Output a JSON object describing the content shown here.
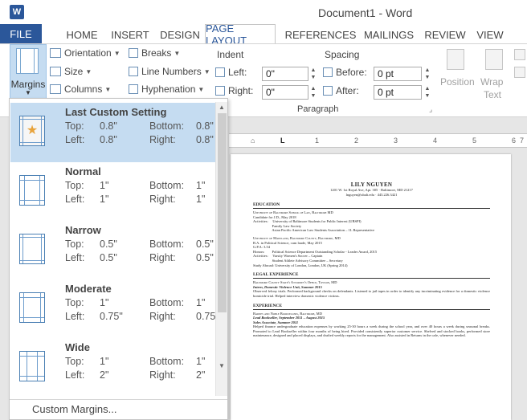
{
  "titlebar": {
    "app_icon": "W",
    "title": "Document1 - Word"
  },
  "tabs": [
    "FILE",
    "HOME",
    "INSERT",
    "DESIGN",
    "PAGE LAYOUT",
    "REFERENCES",
    "MAILINGS",
    "REVIEW",
    "VIEW"
  ],
  "ribbon": {
    "margins": "Margins",
    "orientation": "Orientation",
    "size": "Size",
    "columns": "Columns",
    "breaks": "Breaks",
    "line_numbers": "Line Numbers",
    "hyphenation": "Hyphenation",
    "indent": {
      "title": "Indent",
      "left_label": "Left:",
      "left_value": "0\"",
      "right_label": "Right:",
      "right_value": "0\""
    },
    "spacing": {
      "title": "Spacing",
      "before_label": "Before:",
      "before_value": "0 pt",
      "after_label": "After:",
      "after_value": "0 pt"
    },
    "paragraph_group": "Paragraph",
    "position": "Position",
    "wrap_text_1": "Wrap",
    "wrap_text_2": "Text"
  },
  "ruler": [
    "1",
    "2",
    "3",
    "4",
    "5",
    "6",
    "7"
  ],
  "margin_options": [
    {
      "name": "Last Custom Setting",
      "top": "0.8\"",
      "bottom": "0.8\"",
      "left": "0.8\"",
      "right": "0.8\""
    },
    {
      "name": "Normal",
      "top": "1\"",
      "bottom": "1\"",
      "left": "1\"",
      "right": "1\""
    },
    {
      "name": "Narrow",
      "top": "0.5\"",
      "bottom": "0.5\"",
      "left": "0.5\"",
      "right": "0.5\""
    },
    {
      "name": "Moderate",
      "top": "1\"",
      "bottom": "1\"",
      "left": "0.75\"",
      "right": "0.75\""
    },
    {
      "name": "Wide",
      "top": "1\"",
      "bottom": "1\"",
      "left": "2\"",
      "right": "2\""
    }
  ],
  "labels": {
    "top": "Top:",
    "bottom": "Bottom:",
    "left": "Left:",
    "right": "Right:"
  },
  "custom_margins": "Custom Margins...",
  "document": {
    "name": "LILY NGUYEN",
    "address": "1201 W. 1st Royal Ave, Apt. 305 · Baltimore, MD 21217",
    "contact": "lnguyen@ubalt.edu · 443.226.3421",
    "sections": [
      {
        "heading": "EDUCATION",
        "lines": [
          "University of Baltimore School of Law, Baltimore MD",
          "Candidate for J.D., May 2018",
          "Activities:     University of Baltimore Students for Public Interest (UBSPI)",
          "                     Family Law Society",
          "                     Asian Pacific American Law Students Association – 1L Representative",
          "",
          "University of Maryland, Baltimore County, Baltimore, MD",
          "B.A. in Political Science, cum laude, May 2015",
          "G.P.A: 3.54",
          "Honors:        Political Science Department Outstanding Scholar - Leader Award, 2015",
          "Activities:     Varsity Women's Soccer – Captain",
          "                     Student Athlete Advisory Committee – Secretary",
          "Study Abroad: University of London, London, UK (Spring 2014)"
        ]
      },
      {
        "heading": "LEGAL EXPERIENCE",
        "lines": [
          "Baltimore County State's Attorney's Office, Towson, MD",
          "Intern, Domestic Violence Unit, Summer 2015"
        ],
        "para": "Observed felony trials. Performed background checks on defendants. Listened to jail tapes in order to identify any incriminating evidence for a domestic violence homicide trial. Helped interview domestic violence victims."
      },
      {
        "heading": "EXPERIENCE",
        "lines": [
          "Barnes and Noble Booksellers, Baltimore, MD",
          "Lead Bookseller, September 2011 – August 2015",
          "Sales Associate, Summer 2011"
        ],
        "para": "Helped finance undergraduate education expenses by working 25-30 hours a week during the school year, and over 40 hours a week during seasonal breaks. Promoted to Lead Bookseller within four months of being hired. Provided consistently superior customer service. Shelved and stocked books, performed store maintenance, designed and placed displays, and drafted weekly reports for the management. Also assisted in Returns in the cafe, whenever needed."
      }
    ]
  }
}
